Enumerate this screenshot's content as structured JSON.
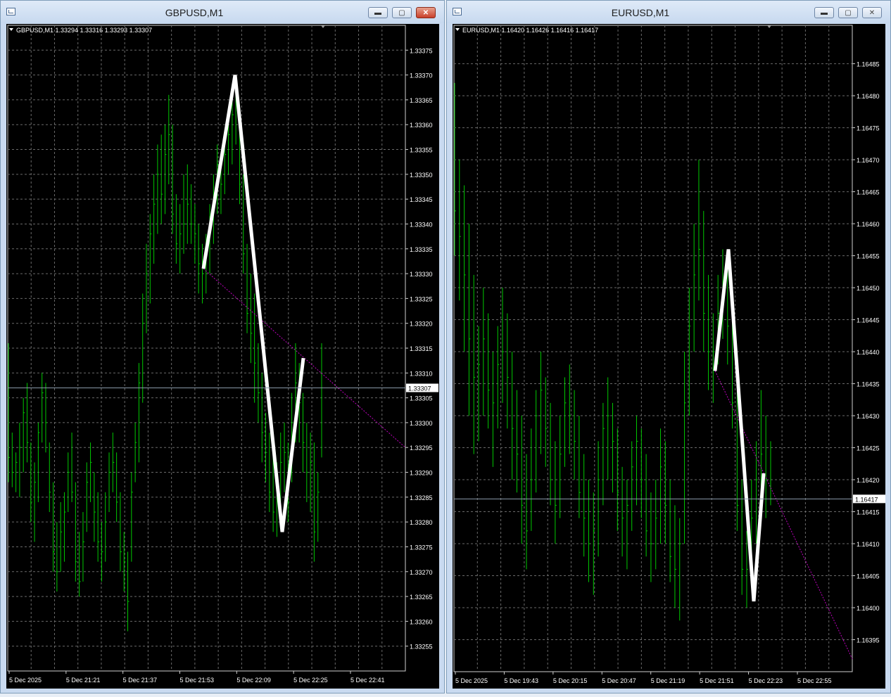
{
  "windows": [
    {
      "title": "GBPUSD,M1",
      "info": "GBPUSD,M1  1.33294 1.33316 1.33293 1.33307",
      "current_price": "1.33307",
      "controls": {
        "minimize": "minimize-button",
        "maximize": "maximize-button",
        "close": "close-button"
      },
      "y_ticks": [
        "1.33375",
        "1.33370",
        "1.33365",
        "1.33360",
        "1.33355",
        "1.33350",
        "1.33345",
        "1.33340",
        "1.33335",
        "1.33330",
        "1.33325",
        "1.33320",
        "1.33315",
        "1.33310",
        "1.33305",
        "1.33300",
        "1.33295",
        "1.33290",
        "1.33285",
        "1.33280",
        "1.33275",
        "1.33270",
        "1.33265",
        "1.33260",
        "1.33255"
      ],
      "x_ticks": [
        "5 Dec 2025",
        "5 Dec 21:21",
        "5 Dec 21:37",
        "5 Dec 21:53",
        "5 Dec 22:09",
        "5 Dec 22:25",
        "5 Dec 22:41"
      ]
    },
    {
      "title": "EURUSD,M1",
      "info": "EURUSD,M1  1.16420 1.16426 1.16416 1.16417",
      "current_price": "1.16417",
      "controls": {
        "minimize": "minimize-button",
        "maximize": "maximize-button",
        "close": "close-button"
      },
      "y_ticks": [
        "1.16485",
        "1.16480",
        "1.16475",
        "1.16470",
        "1.16465",
        "1.16460",
        "1.16455",
        "1.16450",
        "1.16445",
        "1.16440",
        "1.16435",
        "1.16430",
        "1.16425",
        "1.16420",
        "1.16415",
        "1.16410",
        "1.16405",
        "1.16400",
        "1.16395"
      ],
      "x_ticks": [
        "5 Dec 2025",
        "5 Dec 19:43",
        "5 Dec 20:15",
        "5 Dec 20:47",
        "5 Dec 21:19",
        "5 Dec 21:51",
        "5 Dec 22:23",
        "5 Dec 22:55"
      ]
    }
  ],
  "colors": {
    "background": "#000000",
    "bars": "#00c800",
    "grid": "#6a6a6a",
    "zigzag": "#ffffff",
    "trendline": "#c000c0",
    "price_line": "#8a9aaa",
    "text": "#ffffff"
  },
  "chart_data": [
    {
      "type": "bar",
      "title": "GBPUSD,M1",
      "ylim": [
        1.3325,
        1.3338
      ],
      "grid": true,
      "ohlc_bars": [
        [
          1.33316,
          1.33288,
          1.33293
        ],
        [
          1.33298,
          1.33287,
          1.3329
        ],
        [
          1.33294,
          1.33286,
          1.33292
        ],
        [
          1.333,
          1.33285,
          1.33295
        ],
        [
          1.33305,
          1.3329,
          1.33302
        ],
        [
          1.33308,
          1.33292,
          1.33296
        ],
        [
          1.33296,
          1.3328,
          1.33284
        ],
        [
          1.33292,
          1.33276,
          1.33288
        ],
        [
          1.333,
          1.33284,
          1.33298
        ],
        [
          1.3331,
          1.33296,
          1.33306
        ],
        [
          1.33308,
          1.33294,
          1.333
        ],
        [
          1.33296,
          1.33282,
          1.33286
        ],
        [
          1.33288,
          1.3327,
          1.33274
        ],
        [
          1.3328,
          1.33266,
          1.3327
        ],
        [
          1.33284,
          1.3327,
          1.33278
        ],
        [
          1.33286,
          1.33272,
          1.33282
        ],
        [
          1.33294,
          1.33282,
          1.3329
        ],
        [
          1.33298,
          1.33284,
          1.33286
        ],
        [
          1.33288,
          1.33268,
          1.33272
        ],
        [
          1.33278,
          1.33265,
          1.33268
        ],
        [
          1.33282,
          1.33268,
          1.33276
        ],
        [
          1.33292,
          1.33278,
          1.33288
        ],
        [
          1.33296,
          1.33284,
          1.33292
        ],
        [
          1.3329,
          1.33276,
          1.33282
        ],
        [
          1.33286,
          1.33272,
          1.33276
        ],
        [
          1.3328,
          1.33268,
          1.33274
        ],
        [
          1.33286,
          1.33272,
          1.3328
        ],
        [
          1.33294,
          1.33282,
          1.3329
        ],
        [
          1.33298,
          1.33286,
          1.33292
        ],
        [
          1.33294,
          1.3328,
          1.33284
        ],
        [
          1.33286,
          1.3327,
          1.33274
        ],
        [
          1.33278,
          1.33266,
          1.33272
        ],
        [
          1.33274,
          1.33258,
          1.33264
        ],
        [
          1.3329,
          1.33272,
          1.33286
        ],
        [
          1.333,
          1.33288,
          1.33296
        ],
        [
          1.33312,
          1.33292,
          1.33308
        ],
        [
          1.33326,
          1.33304,
          1.3332
        ],
        [
          1.33336,
          1.33318,
          1.3333
        ],
        [
          1.33342,
          1.33324,
          1.33338
        ],
        [
          1.3335,
          1.33332,
          1.33344
        ],
        [
          1.33356,
          1.33338,
          1.3335
        ],
        [
          1.33358,
          1.3334,
          1.33346
        ],
        [
          1.3336,
          1.33342,
          1.33354
        ],
        [
          1.33366,
          1.33348,
          1.33358
        ],
        [
          1.3336,
          1.33338,
          1.33342
        ],
        [
          1.33346,
          1.33332,
          1.33336
        ],
        [
          1.33344,
          1.3333,
          1.33338
        ],
        [
          1.3335,
          1.33334,
          1.3334
        ],
        [
          1.33352,
          1.33336,
          1.33344
        ],
        [
          1.33348,
          1.33336,
          1.3334
        ],
        [
          1.33344,
          1.33332,
          1.33338
        ],
        [
          1.3334,
          1.33326,
          1.33332
        ],
        [
          1.33336,
          1.33324,
          1.3333
        ],
        [
          1.33338,
          1.33326,
          1.33334
        ],
        [
          1.33344,
          1.3333,
          1.3334
        ],
        [
          1.3335,
          1.33336,
          1.33346
        ],
        [
          1.33356,
          1.33342,
          1.33352
        ],
        [
          1.33354,
          1.33342,
          1.33348
        ],
        [
          1.33358,
          1.33346,
          1.33354
        ],
        [
          1.33362,
          1.3335,
          1.33358
        ],
        [
          1.33366,
          1.33352,
          1.33362
        ],
        [
          1.33369,
          1.33356,
          1.33364
        ],
        [
          1.33364,
          1.33344,
          1.33348
        ],
        [
          1.3335,
          1.3333,
          1.33334
        ],
        [
          1.33336,
          1.33318,
          1.33322
        ],
        [
          1.3333,
          1.33312,
          1.33318
        ],
        [
          1.33326,
          1.33304,
          1.33312
        ],
        [
          1.33316,
          1.333,
          1.33306
        ],
        [
          1.3331,
          1.33292,
          1.33298
        ],
        [
          1.33302,
          1.33288,
          1.33294
        ],
        [
          1.33298,
          1.33282,
          1.33286
        ],
        [
          1.33294,
          1.33278,
          1.33282
        ],
        [
          1.33292,
          1.33277,
          1.33286
        ],
        [
          1.33298,
          1.33284,
          1.33292
        ],
        [
          1.333,
          1.33286,
          1.33294
        ],
        [
          1.33296,
          1.3328,
          1.33284
        ],
        [
          1.33306,
          1.33288,
          1.333
        ],
        [
          1.33316,
          1.33296,
          1.33308
        ],
        [
          1.33312,
          1.33296,
          1.33304
        ],
        [
          1.33306,
          1.3329,
          1.33296
        ],
        [
          1.333,
          1.33284,
          1.3329
        ],
        [
          1.33298,
          1.33282,
          1.33292
        ],
        [
          1.33296,
          1.33272,
          1.33278
        ],
        [
          1.3329,
          1.33276,
          1.33286
        ],
        [
          1.33316,
          1.33293,
          1.33307
        ]
      ],
      "zigzag": [
        [
          1.33331,
          0
        ],
        [
          1.3337,
          1
        ],
        [
          1.33278,
          2
        ],
        [
          1.33313,
          3
        ]
      ],
      "trendline": [
        1.33331,
        1.33295
      ],
      "current": 1.33307
    },
    {
      "type": "bar",
      "title": "EURUSD,M1",
      "ylim": [
        1.1639,
        1.16491
      ],
      "grid": true,
      "ohlc_bars": [
        [
          1.16482,
          1.16455,
          1.16462
        ],
        [
          1.1647,
          1.16448,
          1.16458
        ],
        [
          1.16466,
          1.1644,
          1.16452
        ],
        [
          1.1646,
          1.1643,
          1.16442
        ],
        [
          1.16452,
          1.16424,
          1.16436
        ],
        [
          1.16444,
          1.16426,
          1.16438
        ],
        [
          1.1645,
          1.1643,
          1.16442
        ],
        [
          1.16446,
          1.16428,
          1.16434
        ],
        [
          1.1644,
          1.16422,
          1.16432
        ],
        [
          1.16444,
          1.16428,
          1.16438
        ],
        [
          1.1645,
          1.16432,
          1.1644
        ],
        [
          1.16446,
          1.16428,
          1.16436
        ],
        [
          1.1644,
          1.1642,
          1.16428
        ],
        [
          1.16434,
          1.16418,
          1.16424
        ],
        [
          1.1643,
          1.1641,
          1.16416
        ],
        [
          1.16424,
          1.16406,
          1.16412
        ],
        [
          1.16428,
          1.16412,
          1.1642
        ],
        [
          1.16434,
          1.16418,
          1.1643
        ],
        [
          1.1644,
          1.16424,
          1.16434
        ],
        [
          1.16436,
          1.16422,
          1.16428
        ],
        [
          1.16432,
          1.16416,
          1.1642
        ],
        [
          1.16426,
          1.1641,
          1.16416
        ],
        [
          1.1643,
          1.16414,
          1.16424
        ],
        [
          1.16436,
          1.16422,
          1.16432
        ],
        [
          1.16438,
          1.16424,
          1.1643
        ],
        [
          1.16434,
          1.1642,
          1.16426
        ],
        [
          1.1643,
          1.16414,
          1.16418
        ],
        [
          1.16424,
          1.16408,
          1.16414
        ],
        [
          1.1642,
          1.16404,
          1.1641
        ],
        [
          1.16418,
          1.16402,
          1.16412
        ],
        [
          1.16426,
          1.16408,
          1.1642
        ],
        [
          1.16432,
          1.16416,
          1.16428
        ],
        [
          1.16436,
          1.1642,
          1.1643
        ],
        [
          1.16432,
          1.16418,
          1.16426
        ],
        [
          1.16428,
          1.16412,
          1.16418
        ],
        [
          1.16422,
          1.16408,
          1.16414
        ],
        [
          1.1642,
          1.16406,
          1.16416
        ],
        [
          1.16426,
          1.16412,
          1.16422
        ],
        [
          1.1643,
          1.16416,
          1.16426
        ],
        [
          1.16428,
          1.16414,
          1.1642
        ],
        [
          1.16424,
          1.16408,
          1.16412
        ],
        [
          1.16418,
          1.16404,
          1.1641
        ],
        [
          1.1642,
          1.16406,
          1.16414
        ],
        [
          1.16428,
          1.1641,
          1.16422
        ],
        [
          1.16426,
          1.1641,
          1.16416
        ],
        [
          1.1642,
          1.16404,
          1.16408
        ],
        [
          1.16416,
          1.164,
          1.16406
        ],
        [
          1.16414,
          1.16398,
          1.1641
        ],
        [
          1.1644,
          1.1641,
          1.16432
        ],
        [
          1.1645,
          1.1643,
          1.16444
        ],
        [
          1.1646,
          1.1644,
          1.16452
        ],
        [
          1.1647,
          1.16448,
          1.16456
        ],
        [
          1.16462,
          1.1644,
          1.16446
        ],
        [
          1.16452,
          1.16434,
          1.1644
        ],
        [
          1.16446,
          1.16432,
          1.1644
        ],
        [
          1.16452,
          1.16438,
          1.16446
        ],
        [
          1.16456,
          1.16442,
          1.1645
        ],
        [
          1.16454,
          1.16438,
          1.16444
        ],
        [
          1.16446,
          1.16428,
          1.16432
        ],
        [
          1.16434,
          1.16412,
          1.16416
        ],
        [
          1.1642,
          1.16402,
          1.16406
        ],
        [
          1.16412,
          1.164,
          1.16406
        ],
        [
          1.1642,
          1.16404,
          1.16414
        ],
        [
          1.16426,
          1.1641,
          1.1642
        ],
        [
          1.16434,
          1.16414,
          1.16424
        ],
        [
          1.1643,
          1.16414,
          1.1642
        ],
        [
          1.16426,
          1.16416,
          1.16417
        ]
      ],
      "zigzag": [
        [
          1.16437,
          0
        ],
        [
          1.16456,
          1
        ],
        [
          1.16401,
          2
        ],
        [
          1.16421,
          3
        ]
      ],
      "trendline": [
        1.16437,
        1.16392
      ],
      "current": 1.16417
    }
  ]
}
